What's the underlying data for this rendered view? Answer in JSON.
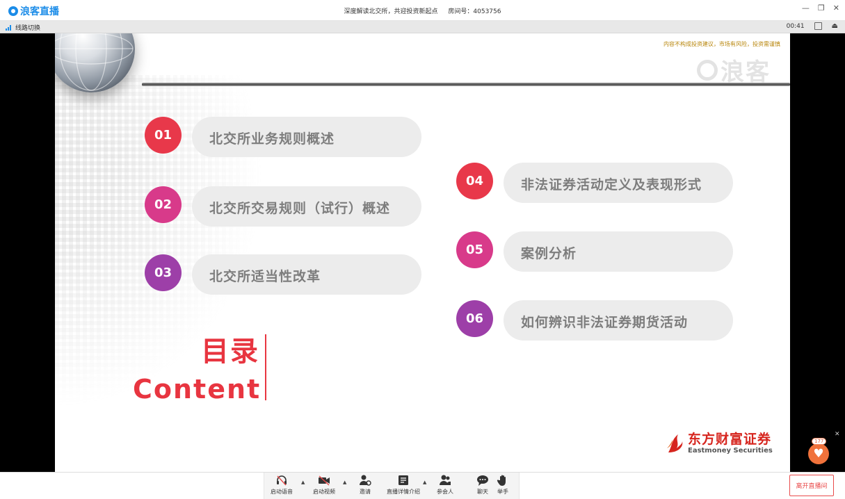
{
  "app": {
    "logo_text": "浪客直播",
    "title": "深度解读北交所，共迎投资新起点",
    "room_label": "房间号：4053756"
  },
  "subbar": {
    "line_switch": "线路切换",
    "time": "00:41"
  },
  "slide": {
    "disclaimer": "内容不构成投资建议，市场有风险，投资需谨慎",
    "watermark": "浪客",
    "items": [
      {
        "num": "01",
        "text": "北交所业务规则概述",
        "color": "#e8384a"
      },
      {
        "num": "02",
        "text": "北交所交易规则（试行）概述",
        "color": "#d83a8a"
      },
      {
        "num": "03",
        "text": "北交所适当性改革",
        "color": "#9d3fa8"
      },
      {
        "num": "04",
        "text": "非法证券活动定义及表现形式",
        "color": "#e8384a"
      },
      {
        "num": "05",
        "text": "案例分析",
        "color": "#d83a8a"
      },
      {
        "num": "06",
        "text": "如何辨识非法证券期货活动",
        "color": "#9d3fa8"
      }
    ],
    "heading_cn": "目录",
    "heading_en": "Content",
    "sponsor_cn": "东方财富证券",
    "sponsor_en": "Eastmoney Securities"
  },
  "like": {
    "count": "177"
  },
  "toolbar": {
    "tools": [
      {
        "label": "启动语音",
        "icon": "headset-mic-icon"
      },
      {
        "label": "启动视频",
        "icon": "video-camera-icon"
      },
      {
        "label": "邀请",
        "icon": "invite-user-icon"
      },
      {
        "label": "直播详情介绍",
        "icon": "document-icon"
      },
      {
        "label": "参会人",
        "icon": "participants-icon"
      },
      {
        "label": "聊天",
        "icon": "chat-bubble-icon"
      },
      {
        "label": "举手",
        "icon": "raise-hand-icon"
      }
    ],
    "leave_label": "离开直播间"
  },
  "colors": {
    "accent": "#1b8ce8",
    "title_red": "#e83540",
    "leave_red": "#e94a4a"
  }
}
